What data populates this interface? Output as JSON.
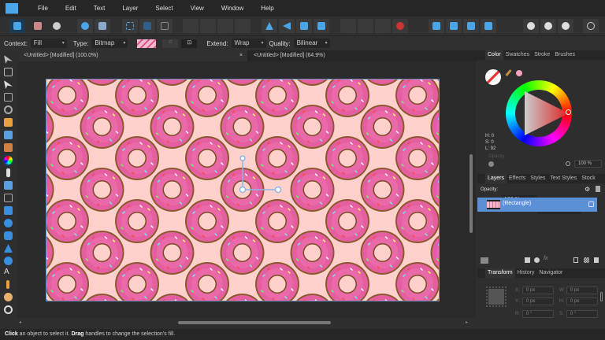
{
  "app": {
    "accent": "#4aa6e8",
    "selection_color": "#5b8fd6"
  },
  "menu": [
    "File",
    "Edit",
    "Text",
    "Layer",
    "Select",
    "View",
    "Window",
    "Help"
  ],
  "context_bar": {
    "context_label": "Context:",
    "context_value": "Fill",
    "type_label": "Type:",
    "type_value": "Bitmap",
    "extend_label": "Extend:",
    "extend_value": "Wrap",
    "quality_label": "Quality:",
    "quality_value": "Bilinear"
  },
  "doc_tabs": [
    {
      "label": "<Untitled> [Modified] (100.0%)",
      "close": "×"
    },
    {
      "label": "<Untitled> [Modified] (64.9%)"
    }
  ],
  "color_panel": {
    "tabs": [
      "Color",
      "Swatches",
      "Stroke",
      "Brushes"
    ],
    "h": "H: 0",
    "s": "S: 0",
    "l": "L: 92",
    "opacity_label": "Opacity",
    "opacity_value": "100 %",
    "swatch_color": "#f4a3bf"
  },
  "layers_panel": {
    "tabs": [
      "Layers",
      "Effects",
      "Styles",
      "Text Styles",
      "Stock"
    ],
    "opacity_label": "Opacity:",
    "opacity_value": "100 %",
    "blend_mode": "Normal",
    "layers": [
      {
        "name": "(Rectangle)",
        "visible": true,
        "selected": true
      }
    ]
  },
  "transform_panel": {
    "tabs": [
      "Transform",
      "History",
      "Navigator"
    ],
    "fields": [
      {
        "label": "X:",
        "value": "0 px"
      },
      {
        "label": "Y:",
        "value": "0 px"
      },
      {
        "label": "R:",
        "value": "0 °"
      },
      {
        "label": "W:",
        "value": "0 px"
      },
      {
        "label": "H:",
        "value": "0 px"
      },
      {
        "label": "S:",
        "value": "0 °"
      }
    ]
  },
  "status": {
    "click": "Click",
    "text1": " an object to select it. ",
    "drag": "Drag",
    "text2": " handles to change the selection's fill."
  }
}
